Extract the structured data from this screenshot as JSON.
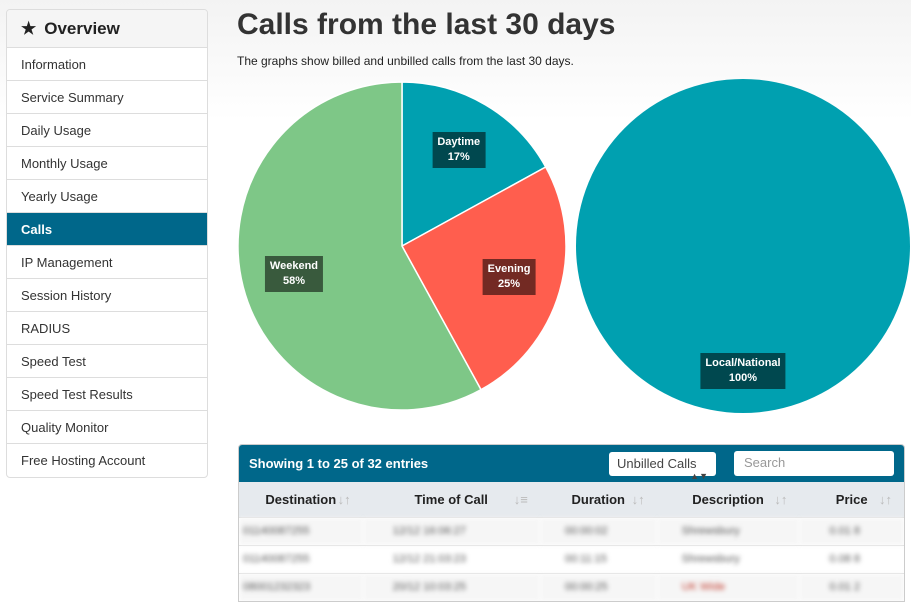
{
  "sidebar": {
    "title": "Overview",
    "items": [
      "Information",
      "Service Summary",
      "Daily Usage",
      "Monthly Usage",
      "Yearly Usage",
      "Calls",
      "IP Management",
      "Session History",
      "RADIUS",
      "Speed Test",
      "Speed Test Results",
      "Quality Monitor",
      "Free Hosting Account"
    ],
    "active": "Calls"
  },
  "page": {
    "title": "Calls from the last 30 days",
    "subtitle": "The graphs show billed and unbilled calls from the last 30 days."
  },
  "chart_data": [
    {
      "type": "pie",
      "slices": [
        {
          "label": "Daytime",
          "value": 17,
          "color": "#00a0b0"
        },
        {
          "label": "Evening",
          "value": 25,
          "color": "#ff5e4e"
        },
        {
          "label": "Weekend",
          "value": 58,
          "color": "#7ec787"
        }
      ]
    },
    {
      "type": "pie",
      "slices": [
        {
          "label": "Local/National",
          "value": 100,
          "color": "#00a0b0"
        }
      ]
    }
  ],
  "table": {
    "info": "Showing 1 to 25 of 32 entries",
    "filter": "Unbilled Calls",
    "search_placeholder": "Search",
    "columns": [
      "Destination",
      "Time of Call",
      "Duration",
      "Description",
      "Price"
    ],
    "rows": [
      [
        "01140087255",
        "12/12 16:06:27",
        "00:00:02",
        "Shrewsbury",
        "0.01 8"
      ],
      [
        "01140087255",
        "12/12 21:03:23",
        "00:11:15",
        "Shrewsbury",
        "0.08 8"
      ],
      [
        "08001232323",
        "20/12 10:03:25",
        "00:00:25",
        "UK Wide",
        "0.01 2"
      ]
    ]
  }
}
